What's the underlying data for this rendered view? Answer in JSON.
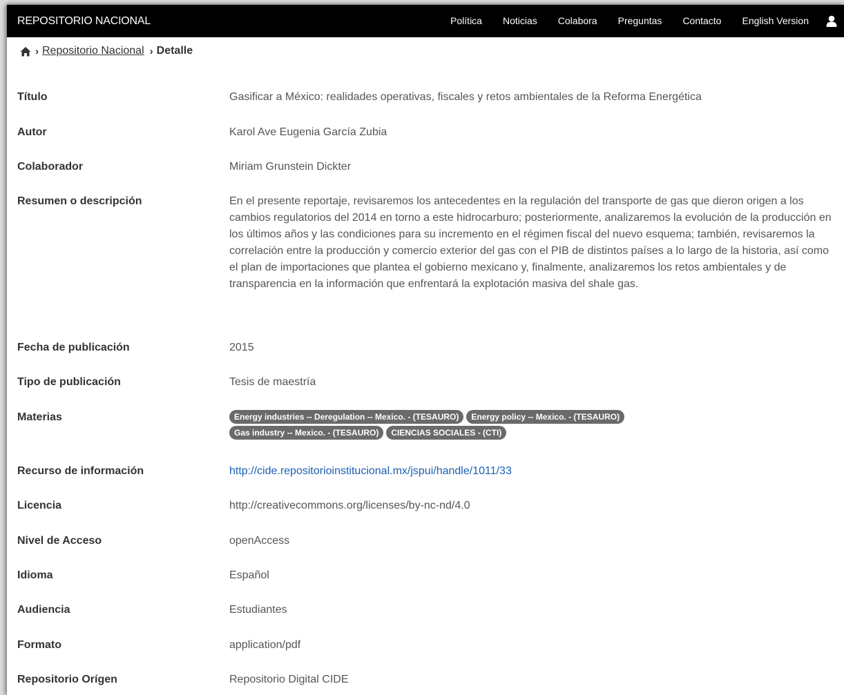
{
  "header": {
    "brand": "REPOSITORIO NACIONAL",
    "nav": [
      "Política",
      "Noticias",
      "Colabora",
      "Preguntas",
      "Contacto",
      "English Version"
    ],
    "user_icon": "user-icon"
  },
  "breadcrumb": {
    "home_icon": "home-icon",
    "separator": "›",
    "link": "Repositorio Nacional",
    "current": "Detalle"
  },
  "fields": {
    "titulo": {
      "label": "Título",
      "value": "Gasificar a México: realidades operativas, fiscales y retos ambientales de la Reforma Energética"
    },
    "autor": {
      "label": "Autor",
      "value": "Karol Ave Eugenia García Zubia"
    },
    "colaborador": {
      "label": "Colaborador",
      "value": "Miriam Grunstein Dickter"
    },
    "resumen": {
      "label": "Resumen o descripción",
      "value": "En el presente reportaje, revisaremos los antecedentes en la regulación del transporte de gas que dieron origen a los cambios regulatorios del 2014 en torno a este hidrocarburo; posteriormente, analizaremos la evolución de la producción en los últimos años y las condiciones para su incremento en el régimen fiscal del nuevo esquema; también, revisaremos la correlación entre la producción y comercio exterior del gas con el PIB de distintos países a lo largo de la historia, así como el plan de importaciones que plantea el gobierno mexicano y, finalmente, analizaremos los retos ambientales y de transparencia en la información que enfrentará la explotación masiva del shale gas."
    },
    "fecha": {
      "label": "Fecha de publicación",
      "value": "2015"
    },
    "tipo": {
      "label": "Tipo de publicación",
      "value": "Tesis de maestría"
    },
    "materias": {
      "label": "Materias",
      "tags": [
        "Energy industries -- Deregulation -- Mexico. - (TESAURO)",
        "Energy policy -- Mexico. - (TESAURO)",
        "Gas industry -- Mexico. - (TESAURO)",
        "CIENCIAS SOCIALES - (CTI)"
      ]
    },
    "recurso": {
      "label": "Recurso de información",
      "value": "http://cide.repositorioinstitucional.mx/jspui/handle/1011/33"
    },
    "licencia": {
      "label": "Licencia",
      "value": "http://creativecommons.org/licenses/by-nc-nd/4.0"
    },
    "nivel": {
      "label": "Nivel de Acceso",
      "value": "openAccess"
    },
    "idioma": {
      "label": "Idioma",
      "value": "Español"
    },
    "audiencia": {
      "label": "Audiencia",
      "value": "Estudiantes"
    },
    "formato": {
      "label": "Formato",
      "value": "application/pdf"
    },
    "repositorio": {
      "label": "Repositorio Orígen",
      "value": "Repositorio Digital CIDE"
    }
  },
  "colors": {
    "navbar_bg": "#000000",
    "link": "#1a5fb4",
    "tag_bg": "#6a6a6a"
  }
}
